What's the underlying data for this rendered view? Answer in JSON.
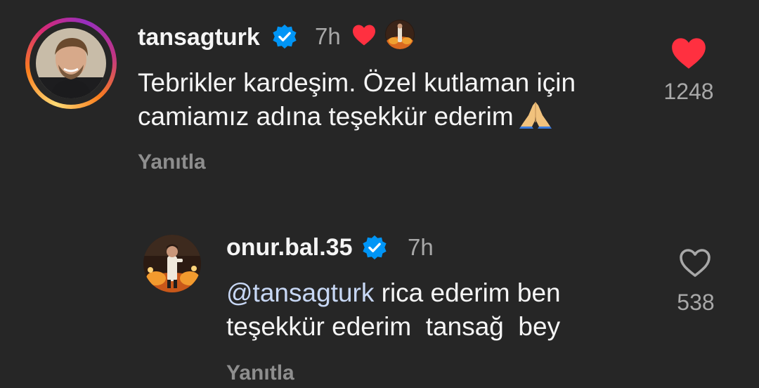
{
  "comment": {
    "username": "tansagturk",
    "time": "7h",
    "text_line1": "Tebrikler kardeşim. Özel kutlaman için",
    "text_line2": "camiamız adına teşekkür ederim",
    "reply_label": "Yanıtla",
    "like_count": "1248",
    "liked": true,
    "liked_by_author_indicator": "heart-icon",
    "verified": true
  },
  "reply": {
    "username": "onur.bal.35",
    "time": "7h",
    "mention": "@tansagturk",
    "text_line1_rest": " rica ederim ben",
    "text_line2": "teşekkür ederim  tansağ  bey",
    "reply_label": "Yanıtla",
    "like_count": "538",
    "liked": false,
    "verified": true
  },
  "colors": {
    "background": "#262626",
    "text": "#f5f5f5",
    "muted": "#a8a8a8",
    "like_red": "#ff3040",
    "verified_blue": "#0095f6",
    "mention": "#c7d7f4"
  }
}
